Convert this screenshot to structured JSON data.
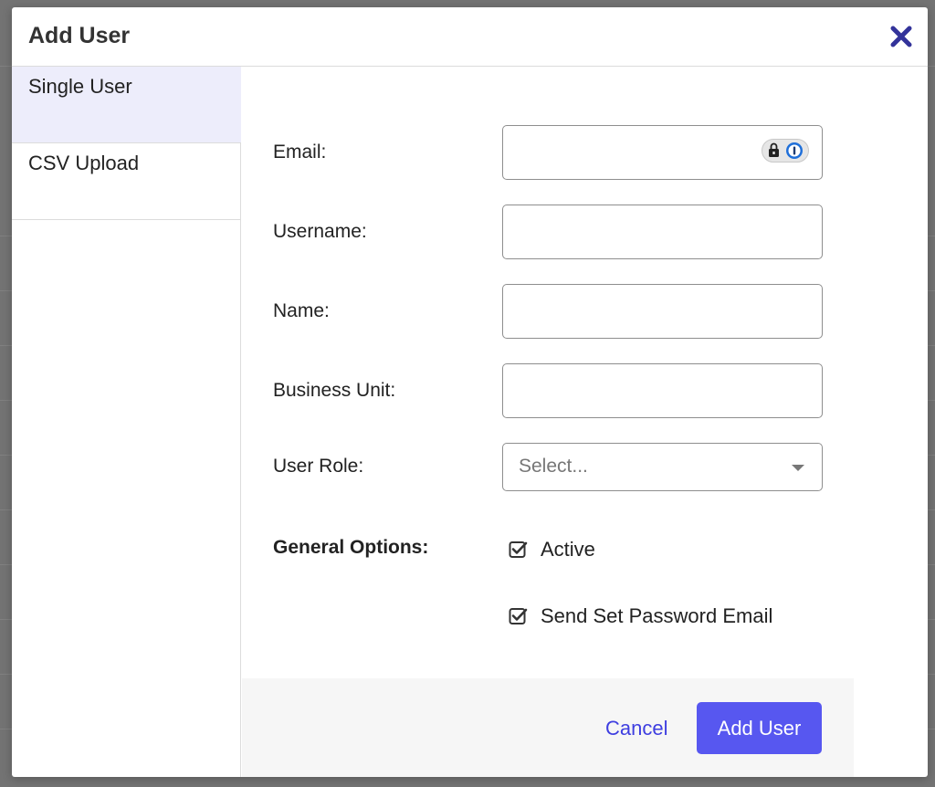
{
  "modal": {
    "title": "Add User"
  },
  "sidebar": {
    "items": [
      {
        "label": "Single User",
        "active": true
      },
      {
        "label": "CSV Upload",
        "active": false
      }
    ]
  },
  "form": {
    "email_label": "Email:",
    "email_value": "",
    "username_label": "Username:",
    "username_value": "",
    "name_label": "Name:",
    "name_value": "",
    "business_unit_label": "Business Unit:",
    "business_unit_value": "",
    "user_role_label": "User Role:",
    "user_role_placeholder": "Select...",
    "general_options_label": "General Options:",
    "options": [
      {
        "label": "Active",
        "checked": true
      },
      {
        "label": "Send Set Password Email",
        "checked": true
      }
    ]
  },
  "footer": {
    "cancel_label": "Cancel",
    "submit_label": "Add User"
  },
  "colors": {
    "accent": "#5757f0",
    "link": "#3e3ee0",
    "close_icon": "#33339a",
    "active_tab_bg": "#ededfb"
  },
  "icons": {
    "close": "close-icon",
    "password_manager": "password-manager-icon",
    "checkbox": "checkbox-checked-icon",
    "dropdown": "chevron-down-icon"
  }
}
